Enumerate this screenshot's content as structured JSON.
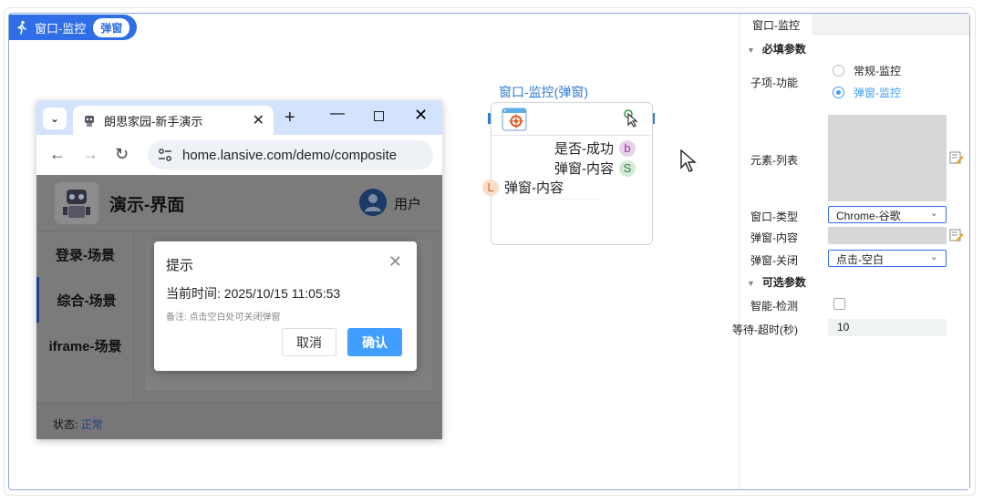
{
  "header": {
    "title": "窗口-监控",
    "tag": "弹窗"
  },
  "browser": {
    "tab_title": "朗思家园-新手演示",
    "url": "home.lansive.com/demo/composite",
    "page": {
      "title": "演示-界面",
      "user": "用户",
      "sidebar": [
        "登录-场景",
        "综合-场景",
        "iframe-场景"
      ],
      "status_label": "状态:",
      "status_value": "正常"
    },
    "modal": {
      "title": "提示",
      "time_label": "当前时间: ",
      "time_value": "2025/10/15 11:05:53",
      "note": "备注: 点击空白处可关闭弹窗",
      "cancel": "取消",
      "confirm": "确认"
    }
  },
  "node": {
    "title": "窗口-监控(弹窗)",
    "outputs": [
      {
        "label": "是否-成功",
        "badge": "b"
      },
      {
        "label": "弹窗-内容",
        "badge": "S"
      }
    ],
    "input": {
      "label": "弹窗-内容",
      "badge": "L"
    }
  },
  "panel": {
    "tab": "窗口-监控",
    "required_section": "必填参数",
    "sub_function_label": "子项-功能",
    "options": [
      "常规-监控",
      "弹窗-监控"
    ],
    "selected_option": "弹窗-监控",
    "element_list_label": "元素-列表",
    "window_type_label": "窗口-类型",
    "window_type_value": "Chrome-谷歌",
    "popup_content_label": "弹窗-内容",
    "popup_close_label": "弹窗-关闭",
    "popup_close_value": "点击-空白",
    "optional_section": "可选参数",
    "smart_detect_label": "智能-检测",
    "timeout_label": "等待-超时(秒)",
    "timeout_value": "10"
  }
}
